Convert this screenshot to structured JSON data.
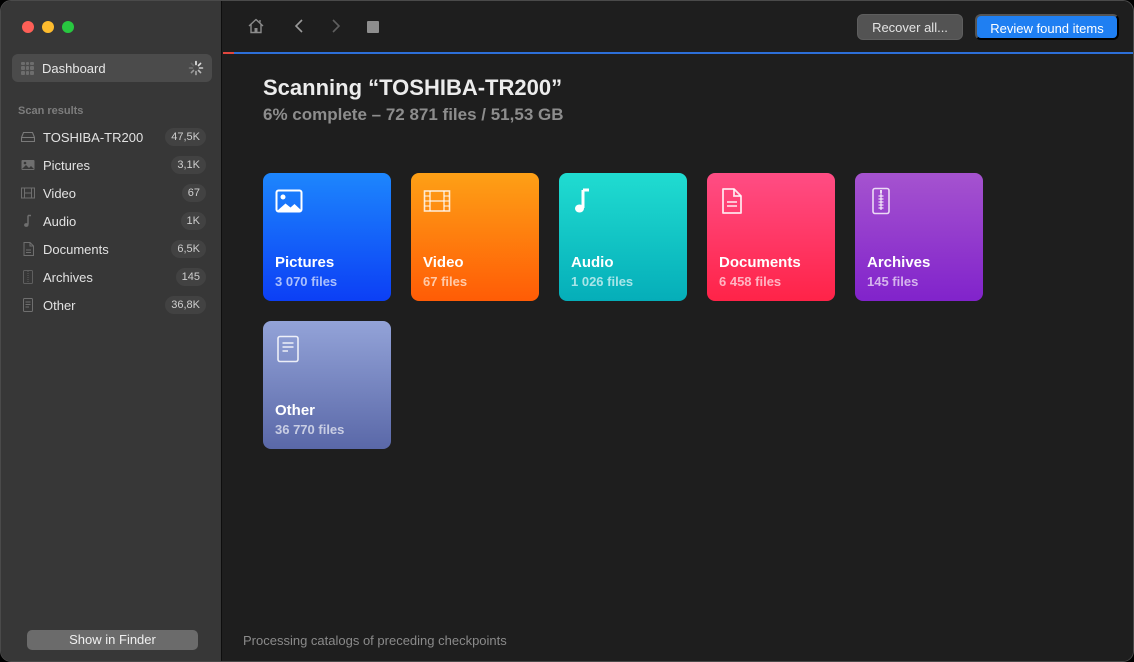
{
  "window": {
    "traffic_lights": [
      "close",
      "minimize",
      "maximize"
    ]
  },
  "sidebar": {
    "dashboard": {
      "label": "Dashboard",
      "icon": "grid-icon",
      "status_icon": "spinner-icon"
    },
    "section_label": "Scan results",
    "items": [
      {
        "label": "TOSHIBA-TR200",
        "count": "47,5K",
        "icon": "drive-icon"
      },
      {
        "label": "Pictures",
        "count": "3,1K",
        "icon": "picture-icon"
      },
      {
        "label": "Video",
        "count": "67",
        "icon": "film-icon"
      },
      {
        "label": "Audio",
        "count": "1K",
        "icon": "music-note-icon"
      },
      {
        "label": "Documents",
        "count": "6,5K",
        "icon": "document-icon"
      },
      {
        "label": "Archives",
        "count": "145",
        "icon": "archive-zip-icon"
      },
      {
        "label": "Other",
        "count": "36,8K",
        "icon": "file-icon"
      }
    ],
    "show_in_finder": "Show in Finder"
  },
  "toolbar": {
    "icons": [
      "home-icon",
      "back-icon",
      "forward-icon",
      "stop-icon"
    ],
    "recover_all": "Recover all...",
    "review_found": "Review found items",
    "accent_color": "#1f7ff2"
  },
  "scan": {
    "title": "Scanning “TOSHIBA-TR200”",
    "subtitle": "6% complete – 72 871 files / 51,53 GB",
    "progress_percent": 6,
    "progress_color": "#e0473f",
    "remaining_color": "#2d6fd8"
  },
  "categories": [
    {
      "name": "Pictures",
      "count": "3 070 files",
      "icon": "picture-icon"
    },
    {
      "name": "Video",
      "count": "67 files",
      "icon": "film-icon"
    },
    {
      "name": "Audio",
      "count": "1 026 files",
      "icon": "music-note-icon"
    },
    {
      "name": "Documents",
      "count": "6 458 files",
      "icon": "document-icon"
    },
    {
      "name": "Archives",
      "count": "145 files",
      "icon": "archive-zip-icon"
    },
    {
      "name": "Other",
      "count": "36 770 files",
      "icon": "file-icon"
    }
  ],
  "status_text": "Processing catalogs of preceding checkpoints"
}
